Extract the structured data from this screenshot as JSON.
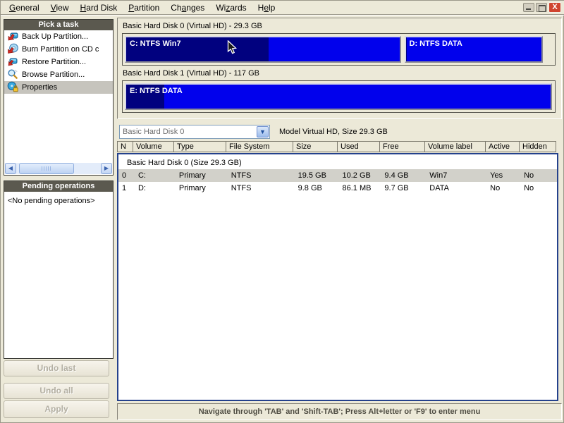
{
  "menu": {
    "items": [
      {
        "label": "General",
        "accel": 0
      },
      {
        "label": "View",
        "accel": 0
      },
      {
        "label": "Hard Disk",
        "accel": 0
      },
      {
        "label": "Partition",
        "accel": 0
      },
      {
        "label": "Changes",
        "accel": 2
      },
      {
        "label": "Wizards",
        "accel": 2
      },
      {
        "label": "Help",
        "accel": 1
      }
    ]
  },
  "window_controls": {
    "minimize": "minimize",
    "maximize": "maximize",
    "close": "X"
  },
  "sidebar": {
    "tasks_header": "Pick a task",
    "tasks": [
      {
        "label": "Back Up Partition...",
        "icon": "backup-disk-icon",
        "selected": false
      },
      {
        "label": "Burn Partition on CD c",
        "icon": "burn-cd-icon",
        "selected": false
      },
      {
        "label": "Restore Partition...",
        "icon": "restore-disk-icon",
        "selected": false
      },
      {
        "label": "Browse Partition...",
        "icon": "browse-magnifier-icon",
        "selected": false
      },
      {
        "label": "Properties",
        "icon": "properties-disk-icon",
        "selected": true
      }
    ],
    "pending_header": "Pending operations",
    "pending_empty": "<No pending operations>",
    "buttons": [
      {
        "label": "Undo last",
        "enabled": false
      },
      {
        "label": "Undo all",
        "enabled": false
      },
      {
        "label": "Apply",
        "enabled": false
      }
    ]
  },
  "disks": [
    {
      "title": "Basic Hard Disk 0 (Virtual HD) - 29.3 GB",
      "partitions": [
        {
          "label": "C: NTFS Win7",
          "width_pct": 64.5,
          "used_pct": 52
        },
        {
          "label": "D: NTFS DATA",
          "width_pct": 32.4,
          "used_pct": 1
        }
      ]
    },
    {
      "title": "Basic Hard Disk 1 (Virtual HD) - 117 GB",
      "partitions": [
        {
          "label": "E: NTFS DATA",
          "width_pct": 99.8,
          "used_pct": 9
        }
      ]
    }
  ],
  "disk_selector": {
    "value": "Basic Hard Disk 0",
    "info": "Model Virtual HD, Size 29.3 GB"
  },
  "table": {
    "columns": [
      {
        "label": "N",
        "width": 23
      },
      {
        "label": "Volume",
        "width": 58
      },
      {
        "label": "Type",
        "width": 74
      },
      {
        "label": "File System",
        "width": 95
      },
      {
        "label": "Size",
        "width": 63
      },
      {
        "label": "Used",
        "width": 60
      },
      {
        "label": "Free",
        "width": 64
      },
      {
        "label": "Volume label",
        "width": 86
      },
      {
        "label": "Active",
        "width": 48
      },
      {
        "label": "Hidden",
        "width": 52
      }
    ],
    "group_row": "Basic Hard Disk 0 (Size 29.3 GB)",
    "rows": [
      {
        "cells": [
          "0",
          "C:",
          "Primary",
          "NTFS",
          "19.5 GB",
          "10.2 GB",
          "9.4 GB",
          "Win7",
          "Yes",
          "No"
        ],
        "selected": true
      },
      {
        "cells": [
          "1",
          "D:",
          "Primary",
          "NTFS",
          "9.8 GB",
          "86.1 MB",
          "9.7 GB",
          "DATA",
          "No",
          "No"
        ],
        "selected": false
      }
    ]
  },
  "status_bar": "Navigate through 'TAB' and 'Shift-TAB'; Press Alt+letter or 'F9' to enter menu",
  "colors": {
    "window_bg": "#ece9d8",
    "partition_blue": "#0101ec",
    "partition_used_blue": "#01017f",
    "section_header_bg": "#5b594f",
    "table_border_blue": "#24418c",
    "selected_row_gray": "#d2d1ca",
    "close_button_red": "#d0442f"
  }
}
